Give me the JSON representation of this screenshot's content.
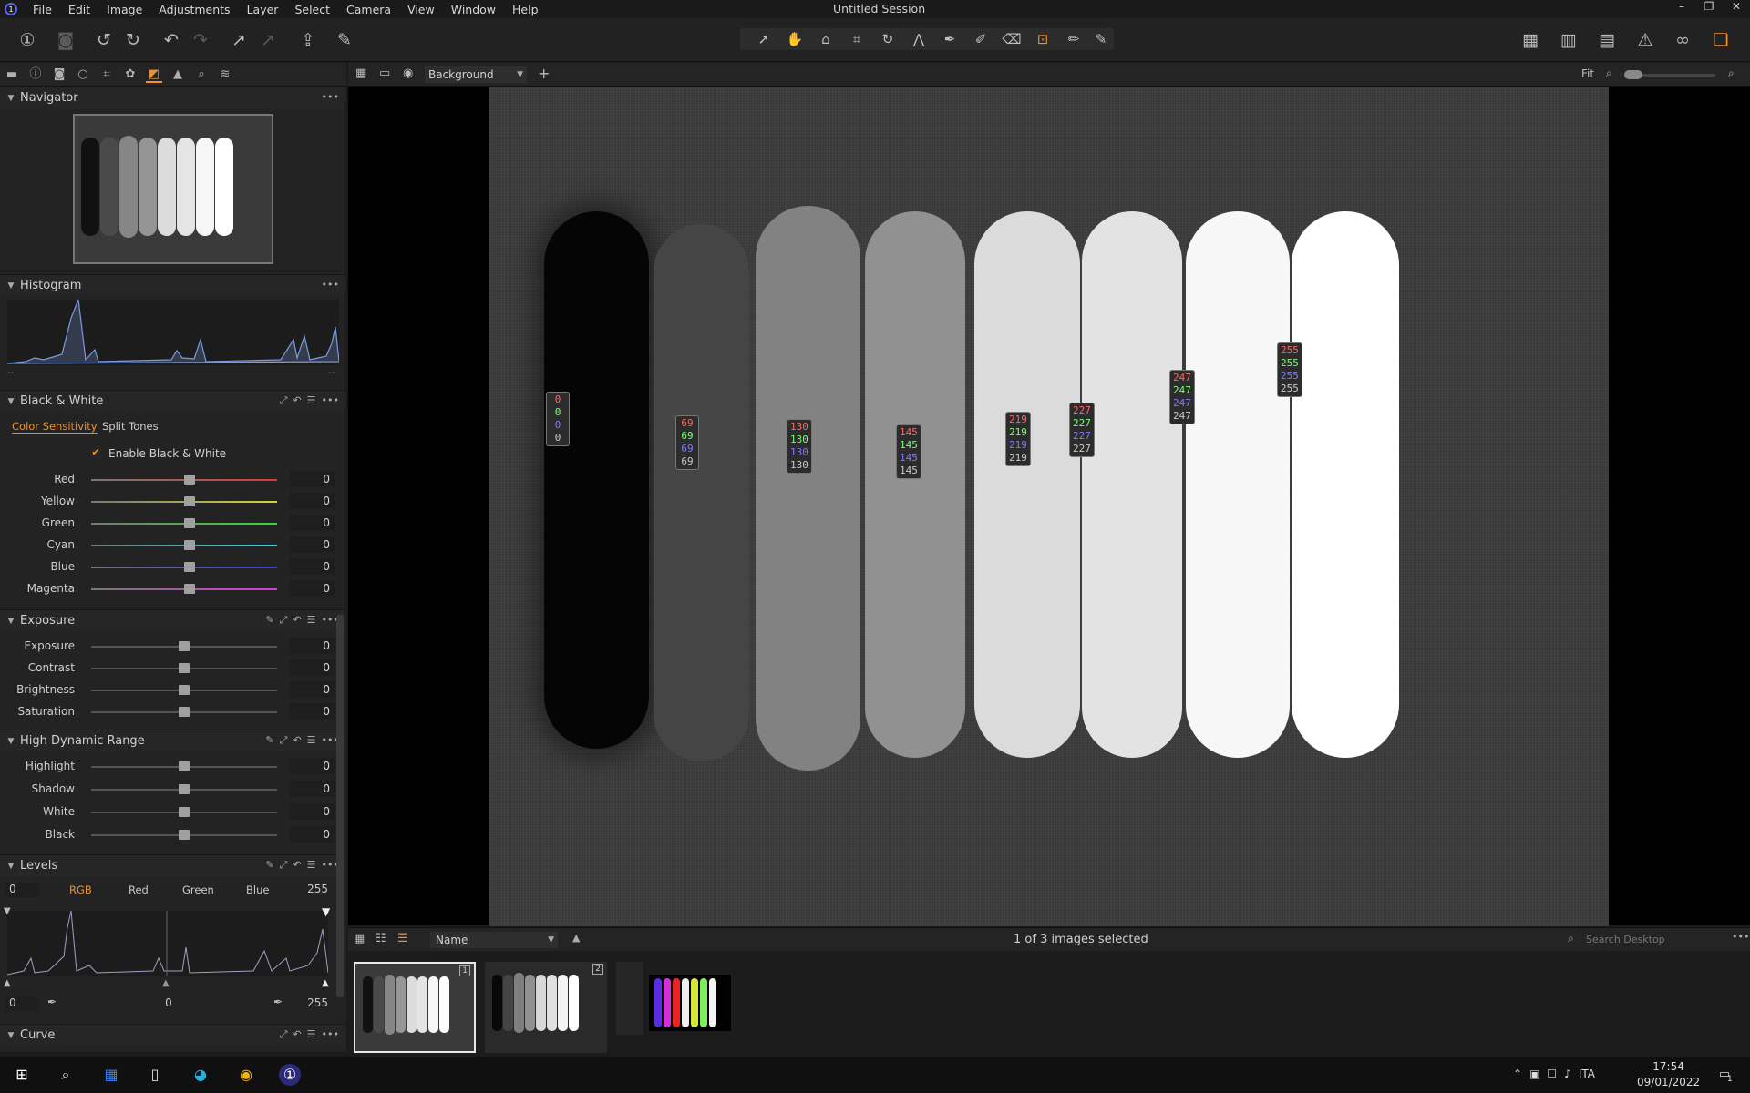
{
  "app": {
    "logo_glyph": "1",
    "window_title": "Untitled Session",
    "menu": [
      "File",
      "Edit",
      "Image",
      "Adjustments",
      "Layer",
      "Select",
      "Camera",
      "View",
      "Window",
      "Help"
    ],
    "window_controls": [
      "–",
      "❐",
      "✕"
    ]
  },
  "toolbar": {
    "left_icons": [
      "capture-one-icon",
      "camera-icon",
      "rotate-left-icon",
      "rotate-right-icon",
      "undo-icon",
      "redo-icon",
      "apply-icon",
      "apply-dim-icon",
      "export-icon",
      "brush-icon"
    ],
    "cursor_tools": [
      "select-cursor-icon",
      "pan-icon",
      "loupe-icon",
      "crop-icon",
      "straighten-icon",
      "keystone-icon",
      "picker-icon",
      "draw-mask-icon",
      "erase-mask-icon",
      "color-readout-icon",
      "annotate-icon",
      "edit-mask-icon"
    ],
    "right_icons": [
      "grid-icon",
      "compare-icon",
      "layout-icon",
      "warning-icon",
      "proof-glasses-icon",
      "workspace-icon"
    ]
  },
  "viewer_bar": {
    "layer": "Background",
    "zoom_label": "Fit"
  },
  "panels": {
    "navigator": {
      "title": "Navigator"
    },
    "histogram": {
      "title": "Histogram",
      "left_value": "--",
      "right_value": "--"
    },
    "bw": {
      "title": "Black & White",
      "tabs": [
        "Color Sensitivity",
        "Split Tones"
      ],
      "enable_label": "Enable Black & White",
      "enabled": true,
      "sliders": [
        {
          "label": "Red",
          "value": "0",
          "color": "#d63b3b"
        },
        {
          "label": "Yellow",
          "value": "0",
          "color": "#d6d23b"
        },
        {
          "label": "Green",
          "value": "0",
          "color": "#3bd63b"
        },
        {
          "label": "Cyan",
          "value": "0",
          "color": "#3bd6d6"
        },
        {
          "label": "Blue",
          "value": "0",
          "color": "#3b3bd6"
        },
        {
          "label": "Magenta",
          "value": "0",
          "color": "#d63bd6"
        }
      ]
    },
    "exposure": {
      "title": "Exposure",
      "sliders": [
        {
          "label": "Exposure",
          "value": "0"
        },
        {
          "label": "Contrast",
          "value": "0"
        },
        {
          "label": "Brightness",
          "value": "0"
        },
        {
          "label": "Saturation",
          "value": "0"
        }
      ]
    },
    "hdr": {
      "title": "High Dynamic Range",
      "sliders": [
        {
          "label": "Highlight",
          "value": "0"
        },
        {
          "label": "Shadow",
          "value": "0"
        },
        {
          "label": "White",
          "value": "0"
        },
        {
          "label": "Black",
          "value": "0"
        }
      ]
    },
    "levels": {
      "title": "Levels",
      "low_input": "0",
      "high_input": "255",
      "channels": [
        "RGB",
        "Red",
        "Green",
        "Blue"
      ],
      "active_channel": "RGB",
      "out_low": "0",
      "midtone": "0",
      "out_high": "255"
    },
    "curve": {
      "title": "Curve"
    }
  },
  "canvas": {
    "bars": [
      {
        "gray": "#050505",
        "readout": [
          "0",
          "0",
          "0",
          "0"
        ]
      },
      {
        "gray": "#454545",
        "readout": [
          "69",
          "69",
          "69",
          "69"
        ]
      },
      {
        "gray": "#828282",
        "readout": [
          "130",
          "130",
          "130",
          "130"
        ]
      },
      {
        "gray": "#919191",
        "readout": [
          "145",
          "145",
          "145",
          "145"
        ]
      },
      {
        "gray": "#dbdbdb",
        "readout": [
          "219",
          "219",
          "219",
          "219"
        ]
      },
      {
        "gray": "#e3e3e3",
        "readout": [
          "227",
          "227",
          "227",
          "227"
        ]
      },
      {
        "gray": "#f7f7f7",
        "readout": [
          "247",
          "247",
          "247",
          "247"
        ]
      },
      {
        "gray": "#ffffff",
        "readout": [
          "255",
          "255",
          "255",
          "255"
        ]
      }
    ]
  },
  "browser": {
    "sort_by": "Name",
    "selection_status": "1 of 3 images selected",
    "search_placeholder": "Search Desktop",
    "thumbs": [
      {
        "number": "1",
        "selected": true
      },
      {
        "number": "2",
        "selected": false
      },
      {
        "number": "",
        "selected": false
      }
    ]
  },
  "taskbar": {
    "language": "ITA",
    "time": "17:54",
    "date": "09/01/2022",
    "notifications": "1"
  }
}
